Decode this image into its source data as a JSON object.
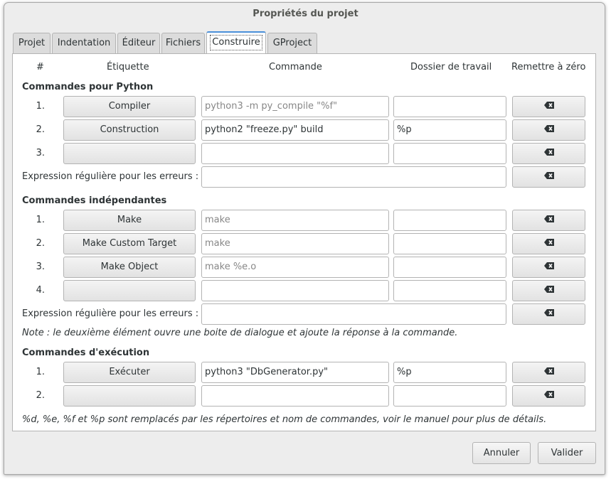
{
  "window": {
    "title": "Propriétés du projet"
  },
  "tabs": [
    {
      "label": "Projet",
      "active": false
    },
    {
      "label": "Indentation",
      "active": false
    },
    {
      "label": "Éditeur",
      "active": false
    },
    {
      "label": "Fichiers",
      "active": false
    },
    {
      "label": "Construire",
      "active": true
    },
    {
      "label": "GProject",
      "active": false
    }
  ],
  "columns": {
    "num": "#",
    "label": "Étiquette",
    "command": "Commande",
    "workdir": "Dossier de travail",
    "reset": "Remettre à zéro"
  },
  "sections": {
    "python": {
      "title": "Commandes pour Python",
      "rows": [
        {
          "num": "1.",
          "label": "Compiler",
          "command": "python3 -m py_compile \"%f\"",
          "workdir": ""
        },
        {
          "num": "2.",
          "label": "Construction",
          "command": "python2 \"freeze.py\" build",
          "workdir": "%p"
        },
        {
          "num": "3.",
          "label": "",
          "command": "",
          "workdir": ""
        }
      ],
      "regex_label": "Expression régulière pour les erreurs :",
      "regex_value": ""
    },
    "independent": {
      "title": "Commandes indépendantes",
      "rows": [
        {
          "num": "1.",
          "label": "Make",
          "command": "make",
          "workdir": ""
        },
        {
          "num": "2.",
          "label": "Make Custom Target",
          "command": "make",
          "workdir": ""
        },
        {
          "num": "3.",
          "label": "Make Object",
          "command": "make %e.o",
          "workdir": ""
        },
        {
          "num": "4.",
          "label": "",
          "command": "",
          "workdir": ""
        }
      ],
      "regex_label": "Expression régulière pour les erreurs :",
      "regex_value": "",
      "note": "Note : le deuxième élément ouvre une boite de dialogue et ajoute la réponse à la commande."
    },
    "execution": {
      "title": "Commandes d'exécution",
      "rows": [
        {
          "num": "1.",
          "label": "Exécuter",
          "command": "python3 \"DbGenerator.py\"",
          "workdir": "%p"
        },
        {
          "num": "2.",
          "label": "",
          "command": "",
          "workdir": ""
        }
      ]
    }
  },
  "footer_note": "%d, %e, %f et %p sont remplacés par les répertoires et nom de commandes, voir le manuel pour plus de détails.",
  "buttons": {
    "cancel": "Annuler",
    "ok": "Valider"
  },
  "icons": {
    "clear": "backspace-icon"
  }
}
